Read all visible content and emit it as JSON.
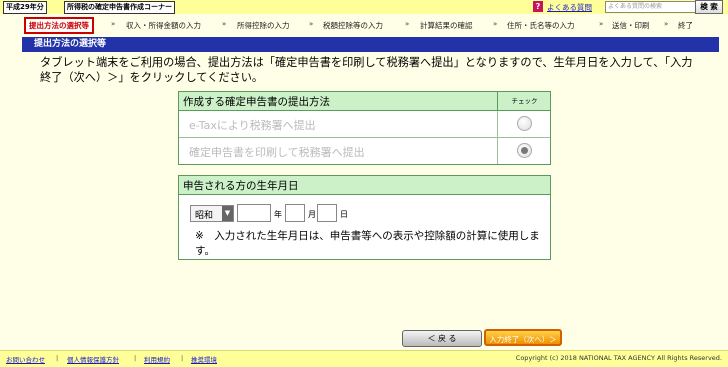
{
  "header": {
    "year_tag": "平成29年分",
    "corner_tag": "所得税の確定申告書作成コーナー",
    "faq_link": "よくある質問",
    "faq_search_placeholder": "よくある質問の検索",
    "search_button": "検 索",
    "help_icon": "question-icon"
  },
  "steps": [
    {
      "label": "提出方法の選択等",
      "active": true
    },
    {
      "label": "収入・所得金額の入力"
    },
    {
      "label": "所得控除の入力"
    },
    {
      "label": "税額控除等の入力"
    },
    {
      "label": "計算結果の確認"
    },
    {
      "label": "住所・氏名等の入力"
    },
    {
      "label": "送信・印刷"
    },
    {
      "label": "終了"
    }
  ],
  "step_arrow": "»",
  "section": {
    "title": "提出方法の選択等",
    "intro": "タブレット端末をご利用の場合、提出方法は「確定申告書を印刷して税務署へ提出」となりますので、生年月日を入力して、「入力終了（次へ）＞」をクリックしてください。"
  },
  "submit_method": {
    "title": "作成する確定申告書の提出方法",
    "check_header": "チェック",
    "options": [
      {
        "label": "e-Taxにより税務署へ提出",
        "selected": false
      },
      {
        "label": "確定申告書を印刷して税務署へ提出",
        "selected": true
      }
    ]
  },
  "birthdate": {
    "title": "申告される方の生年月日",
    "era_value": "昭和",
    "year_value": "",
    "month_value": "",
    "day_value": "",
    "year_unit": "年",
    "month_unit": "月",
    "day_unit": "日",
    "note": "※　入力された生年月日は、申告書等への表示や控除額の計算に使用します。"
  },
  "buttons": {
    "back": "＜ 戻 る",
    "next": "入力終了（次へ）＞"
  },
  "footer": {
    "links": [
      "お問い合わせ",
      "個人情報保護方針",
      "利用規約",
      "推奨環境"
    ],
    "separator": "|",
    "copyright": "Copyright (c) 2018 NATIONAL TAX AGENCY All Rights Reserved."
  },
  "colors": {
    "section_header": "#2233aa",
    "panel_header": "#ccf0c8",
    "next_button": "#f09000",
    "top_bar": "#ffff99"
  }
}
